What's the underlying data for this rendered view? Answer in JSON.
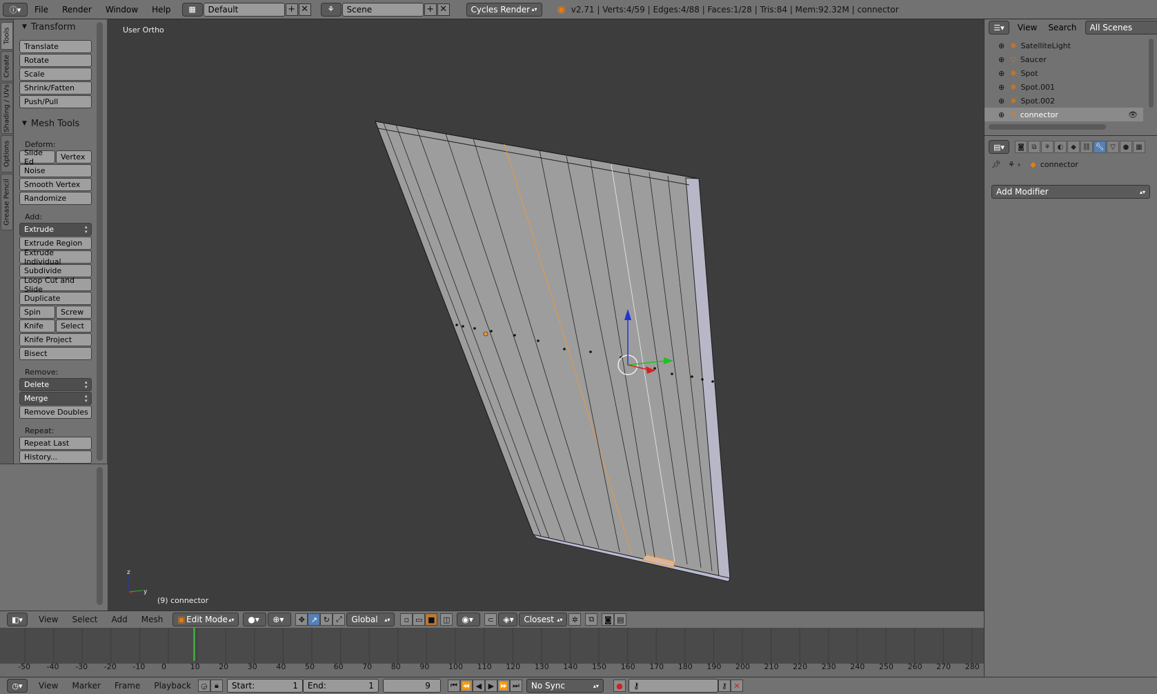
{
  "top": {
    "menus": [
      "File",
      "Render",
      "Window",
      "Help"
    ],
    "layout": "Default",
    "scene": "Scene",
    "engine": "Cycles Render",
    "stats": "v2.71 | Verts:4/59 | Edges:4/88 | Faces:1/28 | Tris:84 | Mem:92.32M | connector"
  },
  "tabs": [
    "Tools",
    "Create",
    "Shading / UVs",
    "Options",
    "Grease Pencil"
  ],
  "tools": {
    "transform_header": "Transform",
    "transform": [
      "Translate",
      "Rotate",
      "Scale",
      "Shrink/Fatten",
      "Push/Pull"
    ],
    "mesh_tools_header": "Mesh Tools",
    "deform_label": "Deform:",
    "slide_edge": "Slide Ed",
    "vertex": "Vertex",
    "noise": "Noise",
    "smooth_vertex": "Smooth Vertex",
    "randomize": "Randomize",
    "add_label": "Add:",
    "extrude": "Extrude",
    "extrude_region": "Extrude Region",
    "extrude_individual": "Extrude Individual",
    "subdivide": "Subdivide",
    "loop_cut": "Loop Cut and Slide",
    "duplicate": "Duplicate",
    "spin": "Spin",
    "screw": "Screw",
    "knife": "Knife",
    "select": "Select",
    "knife_project": "Knife Project",
    "bisect": "Bisect",
    "remove_label": "Remove:",
    "delete": "Delete",
    "merge": "Merge",
    "remove_doubles": "Remove Doubles",
    "repeat_label": "Repeat:",
    "repeat_last": "Repeat Last",
    "history": "History..."
  },
  "viewport": {
    "view_name": "User Ortho",
    "object_info": "(9) connector",
    "axis_z": "z",
    "axis_y": "y"
  },
  "view_header": {
    "menus": [
      "View",
      "Select",
      "Add",
      "Mesh"
    ],
    "mode": "Edit Mode",
    "orientation": "Global",
    "snap": "Closest"
  },
  "timeline": {
    "numbers": [
      "-50",
      "-40",
      "-30",
      "-20",
      "-10",
      "0",
      "10",
      "20",
      "30",
      "40",
      "50",
      "60",
      "70",
      "80",
      "90",
      "100",
      "110",
      "120",
      "130",
      "140",
      "150",
      "160",
      "170",
      "180",
      "190",
      "200",
      "210",
      "220",
      "230",
      "240",
      "250",
      "260",
      "270",
      "280"
    ],
    "current_frame_value": 9
  },
  "timeline_header": {
    "menus": [
      "View",
      "Marker",
      "Frame",
      "Playback"
    ],
    "start_label": "Start:",
    "start_value": "1",
    "end_label": "End:",
    "end_value": "1",
    "frame_value": "9",
    "sync": "No Sync"
  },
  "outliner": {
    "menus": [
      "View",
      "Search"
    ],
    "filter": "All Scenes",
    "items": [
      "SatelliteLight",
      "Saucer",
      "Spot",
      "Spot.001",
      "Spot.002",
      "connector"
    ]
  },
  "properties": {
    "breadcrumb": "connector",
    "add_modifier": "Add Modifier"
  },
  "colors": {
    "viewport_bg": "#3d3d3d",
    "panel_bg": "#727272",
    "active_tab": "#5681b6",
    "selected_edge": "#e89a3c"
  }
}
